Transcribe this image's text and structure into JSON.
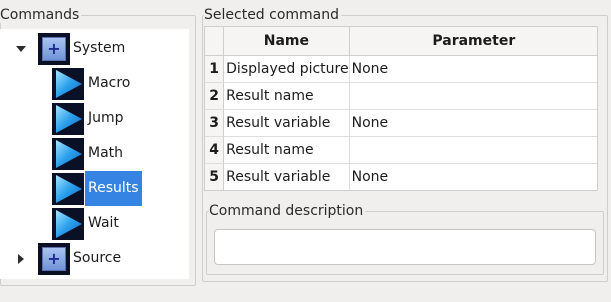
{
  "commands_panel": {
    "title": "Commands",
    "tree": [
      {
        "label": "System",
        "expanded": true,
        "icon": "system-icon"
      },
      {
        "label": "Macro",
        "icon": "play-icon"
      },
      {
        "label": "Jump",
        "icon": "play-icon"
      },
      {
        "label": "Math",
        "icon": "play-icon"
      },
      {
        "label": "Results",
        "icon": "play-icon",
        "selected": true
      },
      {
        "label": "Wait",
        "icon": "play-icon"
      },
      {
        "label": "Source",
        "expanded": false,
        "icon": "system-icon"
      }
    ]
  },
  "selected_command": {
    "title": "Selected command",
    "columns": [
      "Name",
      "Parameter"
    ],
    "rows": [
      {
        "num": "1",
        "name": "Displayed picture",
        "param": "None"
      },
      {
        "num": "2",
        "name": "Result name",
        "param": ""
      },
      {
        "num": "3",
        "name": "Result variable",
        "param": "None"
      },
      {
        "num": "4",
        "name": "Result name",
        "param": ""
      },
      {
        "num": "5",
        "name": "Result variable",
        "param": "None"
      }
    ]
  },
  "command_description": {
    "title": "Command description",
    "value": ""
  },
  "colors": {
    "selection": "#3584e4",
    "window_bg": "#f0efee"
  }
}
